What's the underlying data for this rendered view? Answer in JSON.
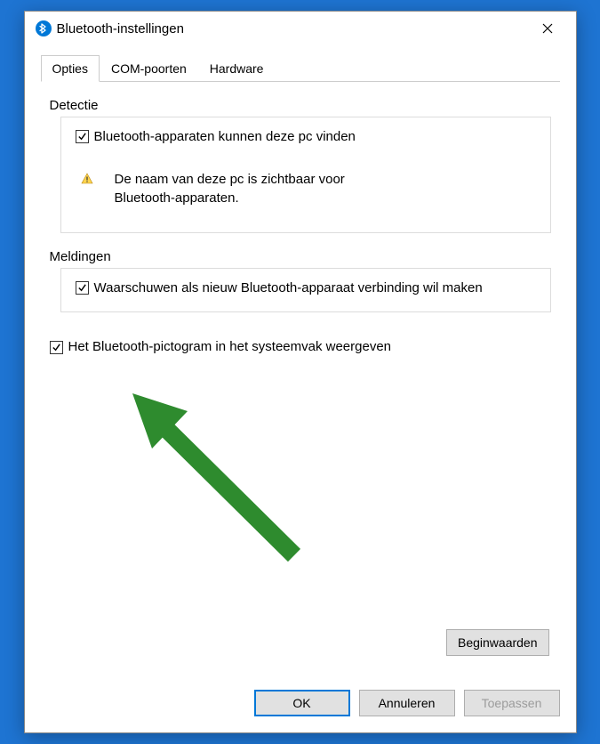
{
  "window": {
    "title": "Bluetooth-instellingen"
  },
  "tabs": {
    "items": [
      {
        "label": "Opties",
        "active": true
      },
      {
        "label": "COM-poorten",
        "active": false
      },
      {
        "label": "Hardware",
        "active": false
      }
    ]
  },
  "detection": {
    "legend": "Detectie",
    "checkbox_label": "Bluetooth-apparaten kunnen deze pc vinden",
    "info_text": "De naam van deze pc is zichtbaar voor Bluetooth-apparaten."
  },
  "notifications": {
    "legend": "Meldingen",
    "checkbox_label": "Waarschuwen als nieuw Bluetooth-apparaat verbinding wil maken"
  },
  "tray_checkbox_label": "Het Bluetooth-pictogram in het systeemvak weergeven",
  "buttons": {
    "defaults": "Beginwaarden",
    "ok": "OK",
    "cancel": "Annuleren",
    "apply": "Toepassen"
  }
}
